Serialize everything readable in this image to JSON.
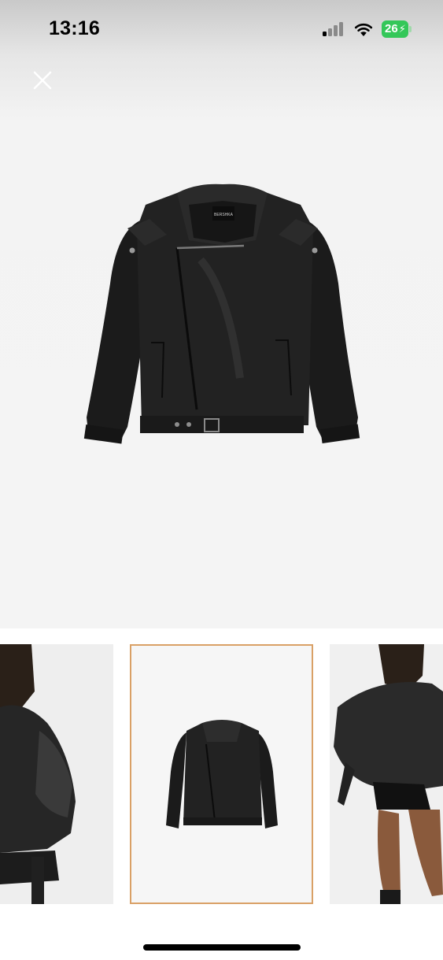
{
  "status_bar": {
    "time": "13:16",
    "battery_level": "26",
    "battery_color": "#34c759",
    "signal_icon": "cellular-signal-icon",
    "wifi_icon": "wifi-icon"
  },
  "viewer": {
    "close_icon": "close-icon",
    "main_image": "black-leather-biker-jacket-product-photo",
    "jacket_label": "BERSHKA"
  },
  "thumbnails": [
    {
      "image": "model-wearing-jacket-side-view",
      "selected": false
    },
    {
      "image": "black-leather-biker-jacket-product-photo",
      "selected": true
    },
    {
      "image": "model-wearing-jacket-back-view",
      "selected": false
    }
  ],
  "colors": {
    "selected_border": "#d9a066",
    "jacket": "#1d1d1d"
  }
}
